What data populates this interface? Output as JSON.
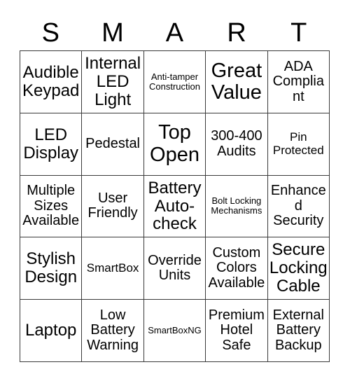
{
  "card": {
    "title_letters": [
      "S",
      "M",
      "A",
      "R",
      "T"
    ],
    "columns": 5,
    "rows": 5,
    "grid_line_color": "#3a3a3a",
    "background_color": "#ffffff",
    "text_color": "#000000",
    "cells": [
      [
        {
          "label": "Audible Keypad",
          "size": "lg"
        },
        {
          "label": "Internal LED Light",
          "size": "lg"
        },
        {
          "label": "Anti-tamper Construction",
          "size": "xs"
        },
        {
          "label": "Great Value",
          "size": "xl"
        },
        {
          "label": "ADA Compliant",
          "size": "md"
        }
      ],
      [
        {
          "label": "LED Display",
          "size": "lg"
        },
        {
          "label": "Pedestal",
          "size": "md"
        },
        {
          "label": "Top Open",
          "size": "xl"
        },
        {
          "label": "300-400 Audits",
          "size": "md"
        },
        {
          "label": "Pin Protected",
          "size": "sm"
        }
      ],
      [
        {
          "label": "Multiple Sizes Available",
          "size": "md"
        },
        {
          "label": "User Friendly",
          "size": "md"
        },
        {
          "label": "Battery Auto-check",
          "size": "lg"
        },
        {
          "label": "Bolt Locking Mechanisms",
          "size": "xs"
        },
        {
          "label": "Enhanced Security",
          "size": "md"
        }
      ],
      [
        {
          "label": "Stylish Design",
          "size": "lg"
        },
        {
          "label": "SmartBox",
          "size": "sm"
        },
        {
          "label": "Override Units",
          "size": "md"
        },
        {
          "label": "Custom Colors Available",
          "size": "md"
        },
        {
          "label": "Secure Locking Cable",
          "size": "lg"
        }
      ],
      [
        {
          "label": "Laptop",
          "size": "lg"
        },
        {
          "label": "Low Battery Warning",
          "size": "md"
        },
        {
          "label": "SmartBoxNG",
          "size": "xs"
        },
        {
          "label": "Premium Hotel Safe",
          "size": "md"
        },
        {
          "label": "External Battery Backup",
          "size": "md"
        }
      ]
    ]
  }
}
